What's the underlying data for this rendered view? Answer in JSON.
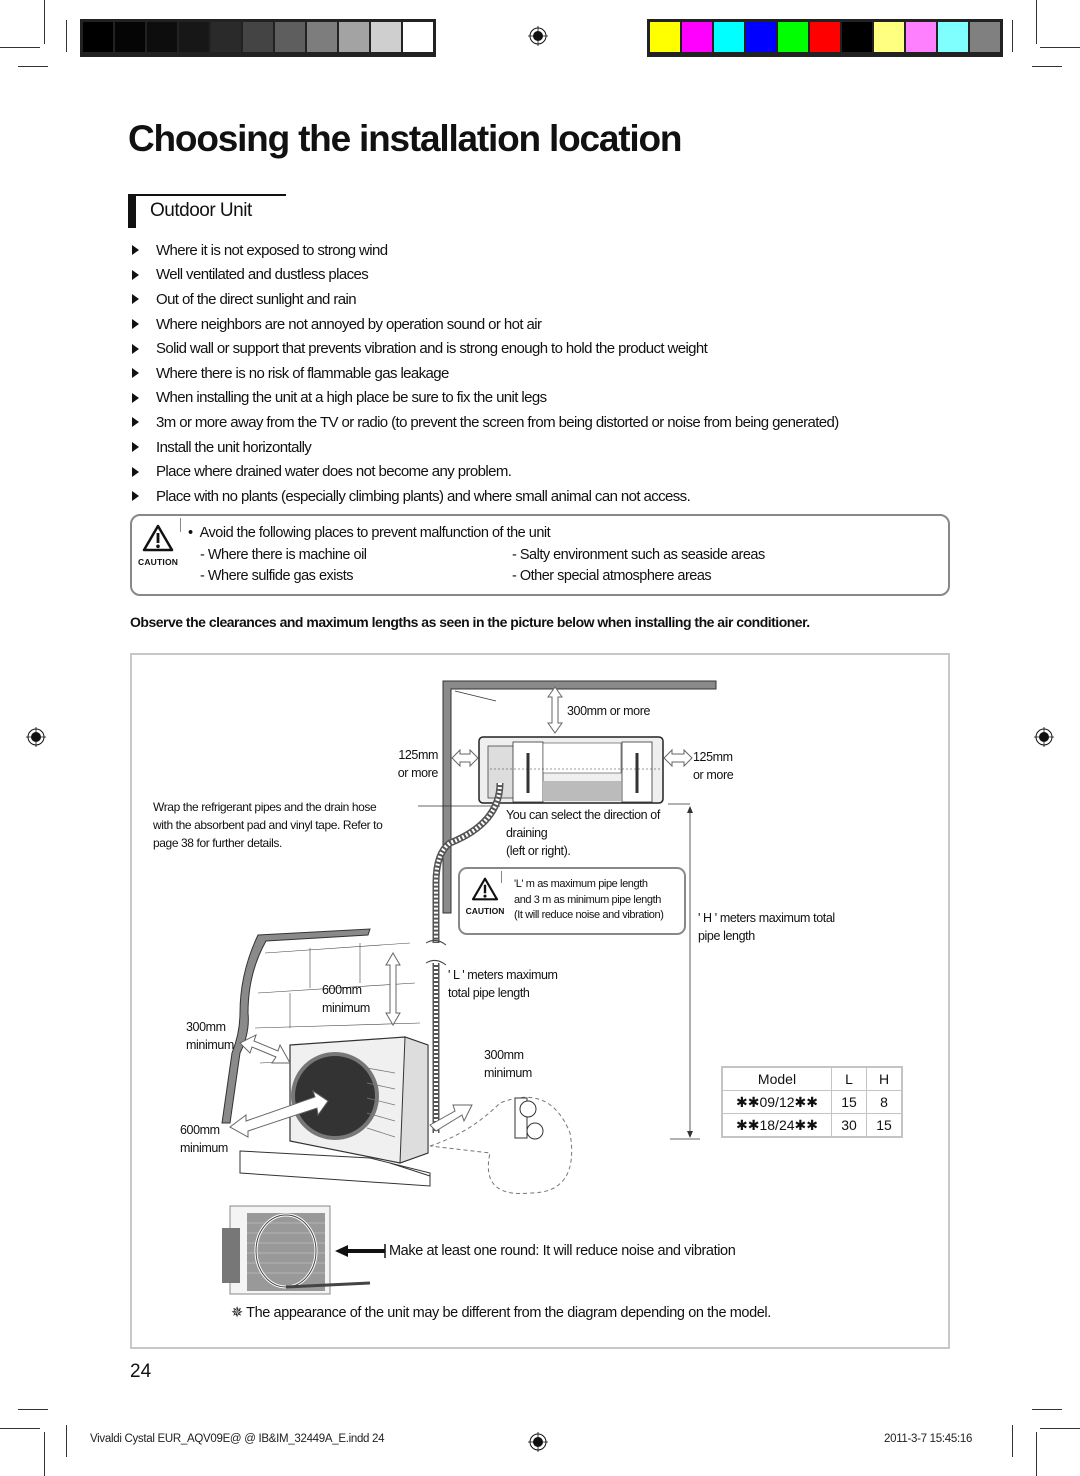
{
  "print_marks": {
    "grayscale_swatches": [
      "#000000",
      "#050505",
      "#0d0d0d",
      "#171717",
      "#2a2a2a",
      "#444444",
      "#5e5e5e",
      "#7d7d7d",
      "#a3a3a3",
      "#cfcfcf",
      "#ffffff"
    ],
    "color_swatches": [
      "#ffff00",
      "#ff00ff",
      "#00ffff",
      "#0000ff",
      "#00ff00",
      "#ff0000",
      "#000000",
      "#ffff80",
      "#ff80ff",
      "#80ffff",
      "#808080"
    ]
  },
  "page": {
    "title": "Choosing the installation location",
    "section_title": "Outdoor Unit",
    "bullets": [
      "Where it is not exposed to strong wind",
      "Well ventilated and dustless places",
      "Out of the direct sunlight and rain",
      "Where neighbors are not annoyed by operation sound or hot air",
      "Solid wall or support that prevents vibration and is strong enough to hold the product weight",
      "Where there is no risk of flammable gas leakage",
      "When installing the unit at a high place be sure to fix the unit legs",
      "3m or more away from the TV or radio (to prevent the screen from being distorted or noise from being generated)",
      "Install the unit horizontally",
      "Place where drained water does not become any problem.",
      "Place with no plants (especially climbing plants) and where small animal can not access."
    ],
    "caution": {
      "icon_label": "CAUTION",
      "heading": "Avoid the following places to prevent malfunction of the unit",
      "items_left": [
        "- Where there is machine oil",
        "- Where sulfide gas exists"
      ],
      "items_right": [
        "- Salty environment such as seaside areas",
        "- Other special atmosphere areas"
      ]
    },
    "observe_text": "Observe the clearances and maximum lengths as seen in the picture below when installing the air conditioner.",
    "page_number": "24"
  },
  "diagram": {
    "top_clearance": "300mm or more",
    "left_clearance": [
      "125mm",
      "or more"
    ],
    "right_clearance": [
      "125mm",
      "or more"
    ],
    "wrap_note": [
      "Wrap the refrigerant pipes and the drain hose",
      "with the absorbent pad and vinyl tape. Refer to",
      "page 38 for further details."
    ],
    "drain_note": [
      "You can select the direction of",
      "draining",
      "(left or right)."
    ],
    "pipe_caution": {
      "icon_label": "CAUTION",
      "lines": [
        "'L' m as maximum pipe length",
        "and 3 m as minimum pipe length",
        "(It will reduce noise and vibration)"
      ]
    },
    "h_note": [
      "' H ' meters maximum total",
      "pipe length"
    ],
    "l_note": [
      "' L ' meters maximum",
      "total pipe length"
    ],
    "outdoor_top": [
      "600mm",
      "minimum"
    ],
    "outdoor_left": [
      "300mm",
      "minimum"
    ],
    "outdoor_right": [
      "300mm",
      "minimum"
    ],
    "outdoor_front": [
      "600mm",
      "minimum"
    ],
    "loop_note": "Make at least one round: It will reduce noise and vibration",
    "appearance_note": "✵ The appearance of the unit may be different from the diagram depending on the model.",
    "table": {
      "headers": [
        "Model",
        "L",
        "H"
      ],
      "rows": [
        [
          "✱✱09/12✱✱",
          "15",
          "8"
        ],
        [
          "✱✱18/24✱✱",
          "30",
          "15"
        ]
      ]
    }
  },
  "footer": {
    "file": "Vivaldi Cystal EUR_AQV09E@ @ IB&IM_32449A_E.indd   24",
    "timestamp": "2011-3-7   15:45:16"
  }
}
